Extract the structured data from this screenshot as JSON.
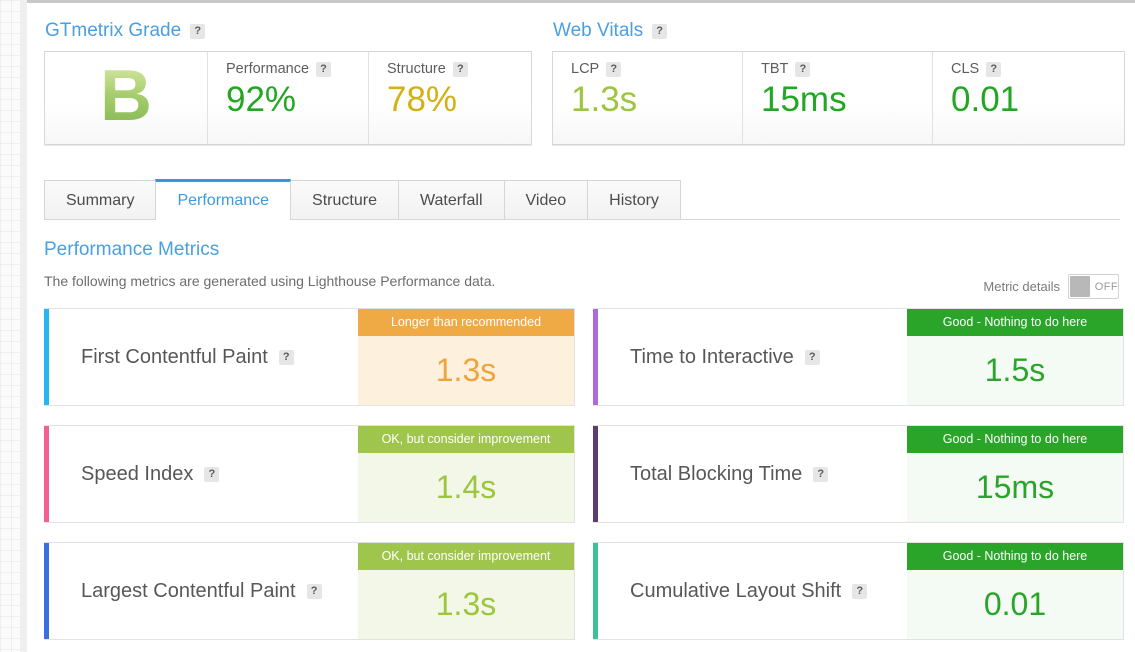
{
  "colors": {
    "link_blue": "#4a9fe0",
    "good_green": "#2aa52a",
    "warn_yellow_green": "#9fc54d",
    "warn_orange": "#efa945",
    "grade_green": "#8cc152"
  },
  "grade_panel": {
    "title": "GTmetrix Grade",
    "help": "?",
    "grade": "B",
    "metrics": [
      {
        "label": "Performance",
        "help": "?",
        "value": "92%",
        "color": "#22a722"
      },
      {
        "label": "Structure",
        "help": "?",
        "value": "78%",
        "color": "#d4b012"
      }
    ]
  },
  "vitals_panel": {
    "title": "Web Vitals",
    "help": "?",
    "metrics": [
      {
        "label": "LCP",
        "help": "?",
        "value": "1.3s",
        "color": "#9cc63c"
      },
      {
        "label": "TBT",
        "help": "?",
        "value": "15ms",
        "color": "#22a722"
      },
      {
        "label": "CLS",
        "help": "?",
        "value": "0.01",
        "color": "#22a722"
      }
    ]
  },
  "tabs": [
    {
      "label": "Summary",
      "active": false
    },
    {
      "label": "Performance",
      "active": true
    },
    {
      "label": "Structure",
      "active": false
    },
    {
      "label": "Waterfall",
      "active": false
    },
    {
      "label": "Video",
      "active": false
    },
    {
      "label": "History",
      "active": false
    }
  ],
  "section": {
    "title": "Performance Metrics",
    "description": "The following metrics are generated using Lighthouse Performance data."
  },
  "metric_details_toggle": {
    "label": "Metric details",
    "state": "OFF"
  },
  "metric_cards": [
    {
      "name": "First Contentful Paint",
      "help": "?",
      "accent": "#29b6f0",
      "banner_text": "Longer than recommended",
      "banner_bg": "#efa945",
      "value": "1.3s",
      "value_color": "#f0a33c",
      "value_bg": "#fdf1dd"
    },
    {
      "name": "Time to Interactive",
      "help": "?",
      "accent": "#b069d8",
      "banner_text": "Good - Nothing to do here",
      "banner_bg": "#2aa52a",
      "value": "1.5s",
      "value_color": "#2ba42b",
      "value_bg": "#f4fbf4"
    },
    {
      "name": "Speed Index",
      "help": "?",
      "accent": "#f4608f",
      "banner_text": "OK, but consider improvement",
      "banner_bg": "#9fc54d",
      "value": "1.4s",
      "value_color": "#9cc63c",
      "value_bg": "#f3f7e8"
    },
    {
      "name": "Total Blocking Time",
      "help": "?",
      "accent": "#5c3d6b",
      "banner_text": "Good - Nothing to do here",
      "banner_bg": "#2aa52a",
      "value": "15ms",
      "value_color": "#2ba42b",
      "value_bg": "#f4fbf4"
    },
    {
      "name": "Largest Contentful Paint",
      "help": "?",
      "accent": "#3a70dd",
      "banner_text": "OK, but consider improvement",
      "banner_bg": "#9fc54d",
      "value": "1.3s",
      "value_color": "#9cc63c",
      "value_bg": "#f3f7e8"
    },
    {
      "name": "Cumulative Layout Shift",
      "help": "?",
      "accent": "#3fc098",
      "banner_text": "Good - Nothing to do here",
      "banner_bg": "#2aa52a",
      "value": "0.01",
      "value_color": "#2ba42b",
      "value_bg": "#f4fbf4"
    }
  ]
}
